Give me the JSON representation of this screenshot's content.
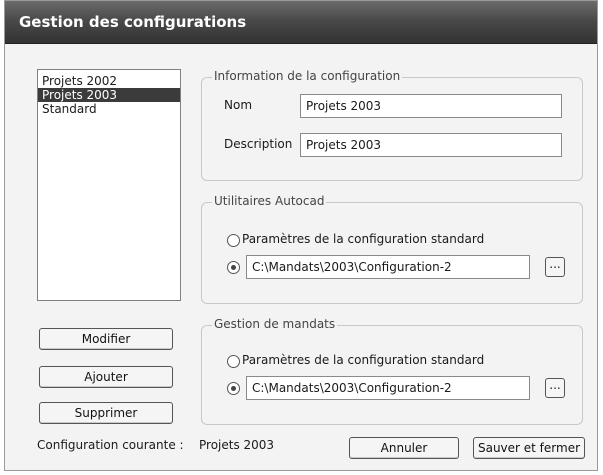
{
  "window": {
    "title": "Gestion des configurations"
  },
  "configurations": {
    "items": [
      "Projets 2002",
      "Projets 2003",
      "Standard"
    ],
    "selected": "Projets 2003"
  },
  "info_group": {
    "legend": "Information de la configuration",
    "nom_label": "Nom",
    "nom_value": "Projets 2003",
    "description_label": "Description",
    "description_value": "Projets 2003"
  },
  "autocad_group": {
    "legend": "Utilitaires Autocad",
    "option_standard": "Paramètres de la configuration standard",
    "path_value": "C:\\Mandats\\2003\\Configuration-2",
    "browse_label": "..."
  },
  "mandats_group": {
    "legend": "Gestion de mandats",
    "option_standard": "Paramètres de la configuration standard",
    "path_value": "C:\\Mandats\\2003\\Configuration-2",
    "browse_label": "..."
  },
  "buttons": {
    "modifier": "Modifier",
    "ajouter": "Ajouter",
    "supprimer": "Supprimer",
    "annuler": "Annuler",
    "sauver": "Sauver et fermer"
  },
  "status": {
    "current_label": "Configuration courante :",
    "current_value": "Projets 2003"
  }
}
